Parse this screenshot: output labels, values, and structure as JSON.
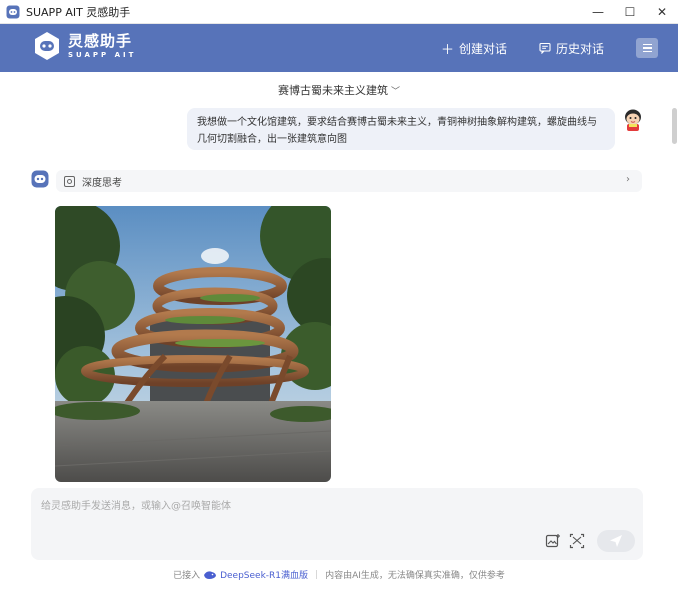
{
  "window": {
    "title": "SUAPP AIT 灵感助手",
    "min_glyph": "—",
    "max_glyph": "☐",
    "close_glyph": "✕"
  },
  "header": {
    "logo_cn": "灵感助手",
    "logo_en": "SUAPP AIT",
    "new_chat_label": "创建对话",
    "history_label": "历史对话"
  },
  "conversation": {
    "title": "赛博古蜀未来主义建筑"
  },
  "messages": {
    "user_text": "我想做一个文化馆建筑，要求结合赛博古蜀未来主义，青铜神树抽象解构建筑，螺旋曲线与几何切割融合，出一张建筑意向图",
    "thinking_label": "深度思考"
  },
  "input": {
    "placeholder": "给灵感助手发送消息，或输入@召唤智能体"
  },
  "footer": {
    "prefix": "已接入",
    "model": "DeepSeek-R1满血版",
    "disclaimer": "内容由AI生成，无法确保真实准确，仅供参考"
  },
  "colors": {
    "header_bg": "#5773b9",
    "bubble_bg": "#eef1f8",
    "input_bg": "#f4f5f7",
    "accent": "#4a5fd0"
  }
}
